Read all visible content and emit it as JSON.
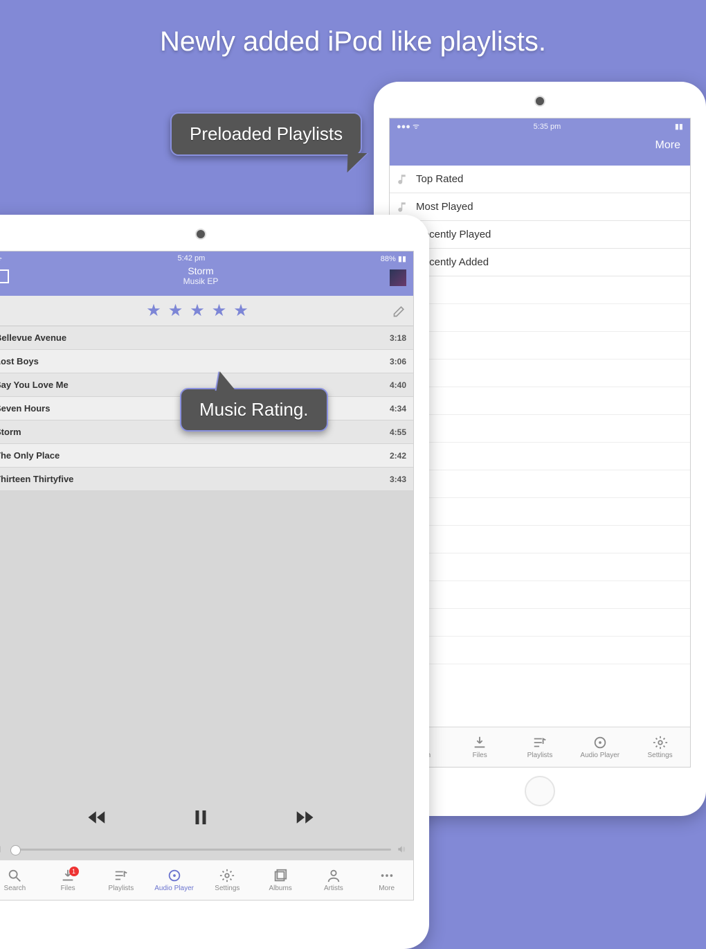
{
  "headline": "Newly added iPod like playlists.",
  "callouts": {
    "preloaded": "Preloaded Playlists",
    "rating": "Music Rating."
  },
  "back": {
    "status": {
      "time": "5:35 pm",
      "more": "More"
    },
    "playlists": [
      "Top Rated",
      "Most Played",
      "Recently Played",
      "Recently Added"
    ],
    "tabs": [
      "Search",
      "Files",
      "Playlists",
      "Audio Player",
      "Settings"
    ]
  },
  "front": {
    "status": {
      "time": "5:42 pm",
      "battery": "88%"
    },
    "now_playing": {
      "song": "Storm",
      "album": "Musik EP"
    },
    "rating": 5,
    "tracks": [
      {
        "name": "Bellevue Avenue",
        "time": "3:18"
      },
      {
        "name": "Lost Boys",
        "time": "3:06"
      },
      {
        "name": "Say You Love Me",
        "time": "4:40"
      },
      {
        "name": "Seven Hours",
        "time": "4:34"
      },
      {
        "name": "Storm",
        "time": "4:55"
      },
      {
        "name": "The Only Place",
        "time": "2:42"
      },
      {
        "name": "Thirteen Thirtyfive",
        "time": "3:43"
      }
    ],
    "tabs": [
      "Search",
      "Files",
      "Playlists",
      "Audio Player",
      "Settings",
      "Albums",
      "Artists",
      "More"
    ],
    "active_tab": "Audio Player",
    "files_badge": "1"
  }
}
